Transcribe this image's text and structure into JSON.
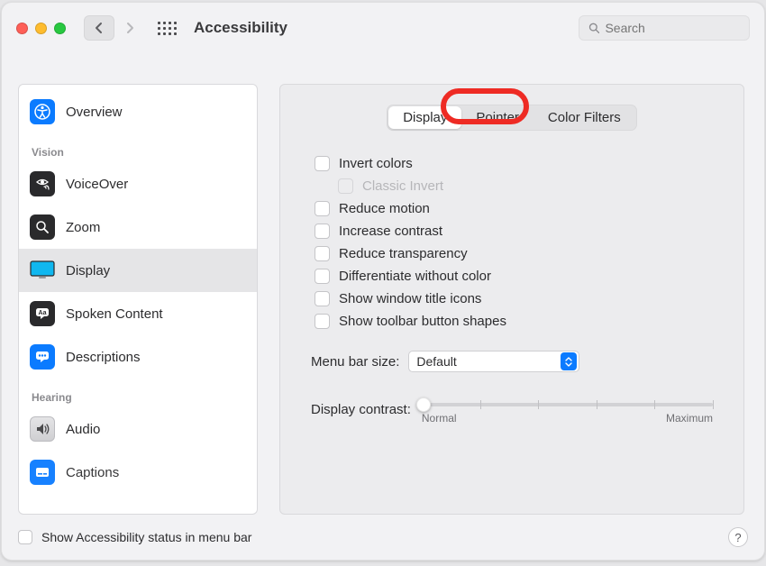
{
  "window": {
    "title": "Accessibility"
  },
  "search": {
    "placeholder": "Search"
  },
  "sidebar": {
    "overview": "Overview",
    "cat_vision": "Vision",
    "voiceover": "VoiceOver",
    "zoom": "Zoom",
    "display": "Display",
    "spoken": "Spoken Content",
    "descriptions": "Descriptions",
    "cat_hearing": "Hearing",
    "audio": "Audio",
    "captions": "Captions"
  },
  "tabs": {
    "display": "Display",
    "pointer": "Pointer",
    "filters": "Color Filters",
    "active": "display"
  },
  "options": {
    "invert": "Invert colors",
    "classic": "Classic Invert",
    "reduce_motion": "Reduce motion",
    "increase_contrast": "Increase contrast",
    "reduce_transparency": "Reduce transparency",
    "diff_without_color": "Differentiate without color",
    "show_title_icons": "Show window title icons",
    "show_toolbar_shapes": "Show toolbar button shapes"
  },
  "menu_bar": {
    "label": "Menu bar size:",
    "value": "Default"
  },
  "contrast": {
    "label": "Display contrast:",
    "min": "Normal",
    "max": "Maximum",
    "value_pct": 0
  },
  "footer": {
    "label": "Show Accessibility status in menu bar"
  }
}
